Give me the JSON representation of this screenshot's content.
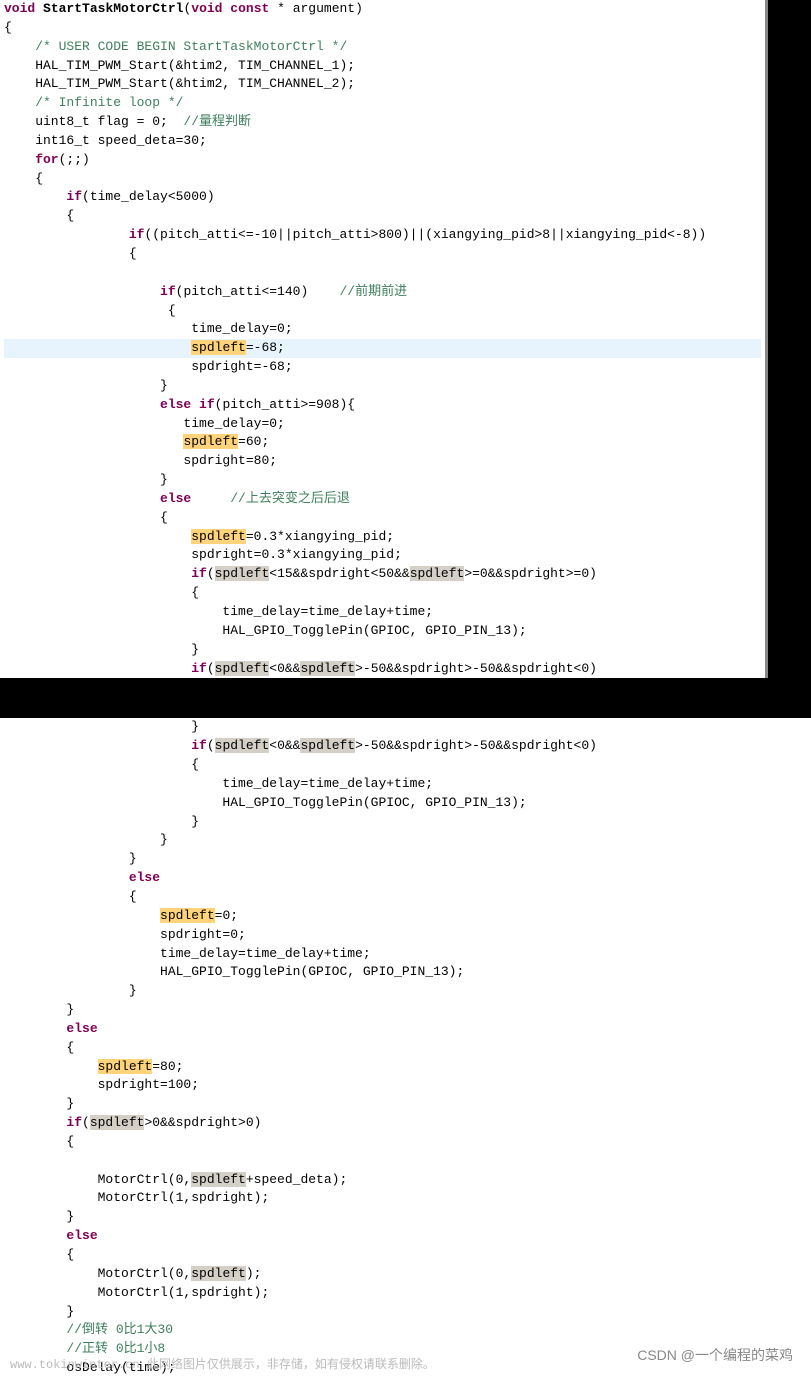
{
  "block1": {
    "l1a": "void",
    "l1b": "StartTaskMotorCtrl",
    "l1c": "void const",
    "l1d": " * argument)",
    "l2": "{",
    "l3": "    /* USER CODE BEGIN StartTaskMotorCtrl */",
    "l4": "    HAL_TIM_PWM_Start(&htim2, TIM_CHANNEL_1);",
    "l5": "    HAL_TIM_PWM_Start(&htim2, TIM_CHANNEL_2);",
    "l6": "    /* Infinite loop */",
    "l7a": "    uint8_t flag = 0;  ",
    "l7b": "//量程判断",
    "l8": "    int16_t speed_deta=30;",
    "l9a": "    for",
    "l9b": "(;;)",
    "l10": "    {",
    "l11a": "        if",
    "l11b": "(time_delay<5000)",
    "l12": "        {",
    "l13a": "                if",
    "l13b": "((pitch_atti<=-10||pitch_atti>800)||(xiangying_pid>8||xiangying_pid<-8))",
    "l14": "                {",
    "l15": "",
    "l16a": "                    if",
    "l16b": "(pitch_atti<=140)    ",
    "l16c": "//前期前进",
    "l17": "                     {",
    "l18": "                        time_delay=0;",
    "l19a": "                        ",
    "l19b": "spdleft",
    "l19c": "=-68;",
    "l20": "                        spdright=-68;",
    "l21": "                    }",
    "l22a": "                    else if",
    "l22b": "(pitch_atti>=908){",
    "l23": "                       time_delay=0;",
    "l24a": "                       ",
    "l24b": "spdleft",
    "l24c": "=60;",
    "l25": "                       spdright=80;",
    "l26": "                    }",
    "l27a": "                    else",
    "l27b": "     //上去突变之后后退",
    "l28": "                    {",
    "l29a": "                        ",
    "l29b": "spdleft",
    "l29c": "=0.3*xiangying_pid;",
    "l30": "                        spdright=0.3*xiangying_pid;",
    "l31a": "                        if",
    "l31b": "(",
    "l31c": "spdleft",
    "l31d": "<15&&spdright<50&&",
    "l31e": "spdleft",
    "l31f": ">=0&&spdright>=0)",
    "l32": "                        {",
    "l33": "                            time_delay=time_delay+time;",
    "l34": "                            HAL_GPIO_TogglePin(GPIOC, GPIO_PIN_13);",
    "l35": "                        }",
    "l36a": "                        if",
    "l36b": "(",
    "l36c": "spdleft",
    "l36d": "<0&&",
    "l36e": "spdleft",
    "l36f": ">-50&&spdright>-50&&spdright<0)"
  },
  "block2": {
    "l1": "                        }",
    "l2a": "                        if",
    "l2b": "(",
    "l2c": "spdleft",
    "l2d": "<0&&",
    "l2e": "spdleft",
    "l2f": ">-50&&spdright>-50&&spdright<0)",
    "l3": "                        {",
    "l4": "                            time_delay=time_delay+time;",
    "l5": "                            HAL_GPIO_TogglePin(GPIOC, GPIO_PIN_13);",
    "l6": "                        }",
    "l7": "                    }",
    "l8": "                }",
    "l9": "                else",
    "l10": "                {",
    "l11a": "                    ",
    "l11b": "spdleft",
    "l11c": "=0;",
    "l12": "                    spdright=0;",
    "l13": "                    time_delay=time_delay+time;",
    "l14": "                    HAL_GPIO_TogglePin(GPIOC, GPIO_PIN_13);",
    "l15": "                }",
    "l16": "        }",
    "l17": "        else",
    "l18": "        {",
    "l19a": "            ",
    "l19b": "spdleft",
    "l19c": "=80;",
    "l20": "            spdright=100;",
    "l21": "        }",
    "l22a": "        if",
    "l22b": "(",
    "l22c": "spdleft",
    "l22d": ">0&&spdright>0)",
    "l23": "        {",
    "l24": "",
    "l25a": "            MotorCtrl(0,",
    "l25b": "spdleft",
    "l25c": "+speed_deta);",
    "l26": "            MotorCtrl(1,spdright);",
    "l27": "        }",
    "l28": "        else",
    "l29": "        {",
    "l30a": "            MotorCtrl(0,",
    "l30b": "spdleft",
    "l30c": ");",
    "l31": "            MotorCtrl(1,spdright);",
    "l32": "        }",
    "l33a": "        ",
    "l33b": "//倒转 0比1大30",
    "l34a": "        ",
    "l34b": "//正转 0比1小8",
    "l35": "        osDelay(time);"
  },
  "watermark_left": "www.tokinwinter.cn 此网络图片仅供展示，非存储，如有侵权请联系删除。",
  "watermark_right": "CSDN @一个编程的菜鸡"
}
